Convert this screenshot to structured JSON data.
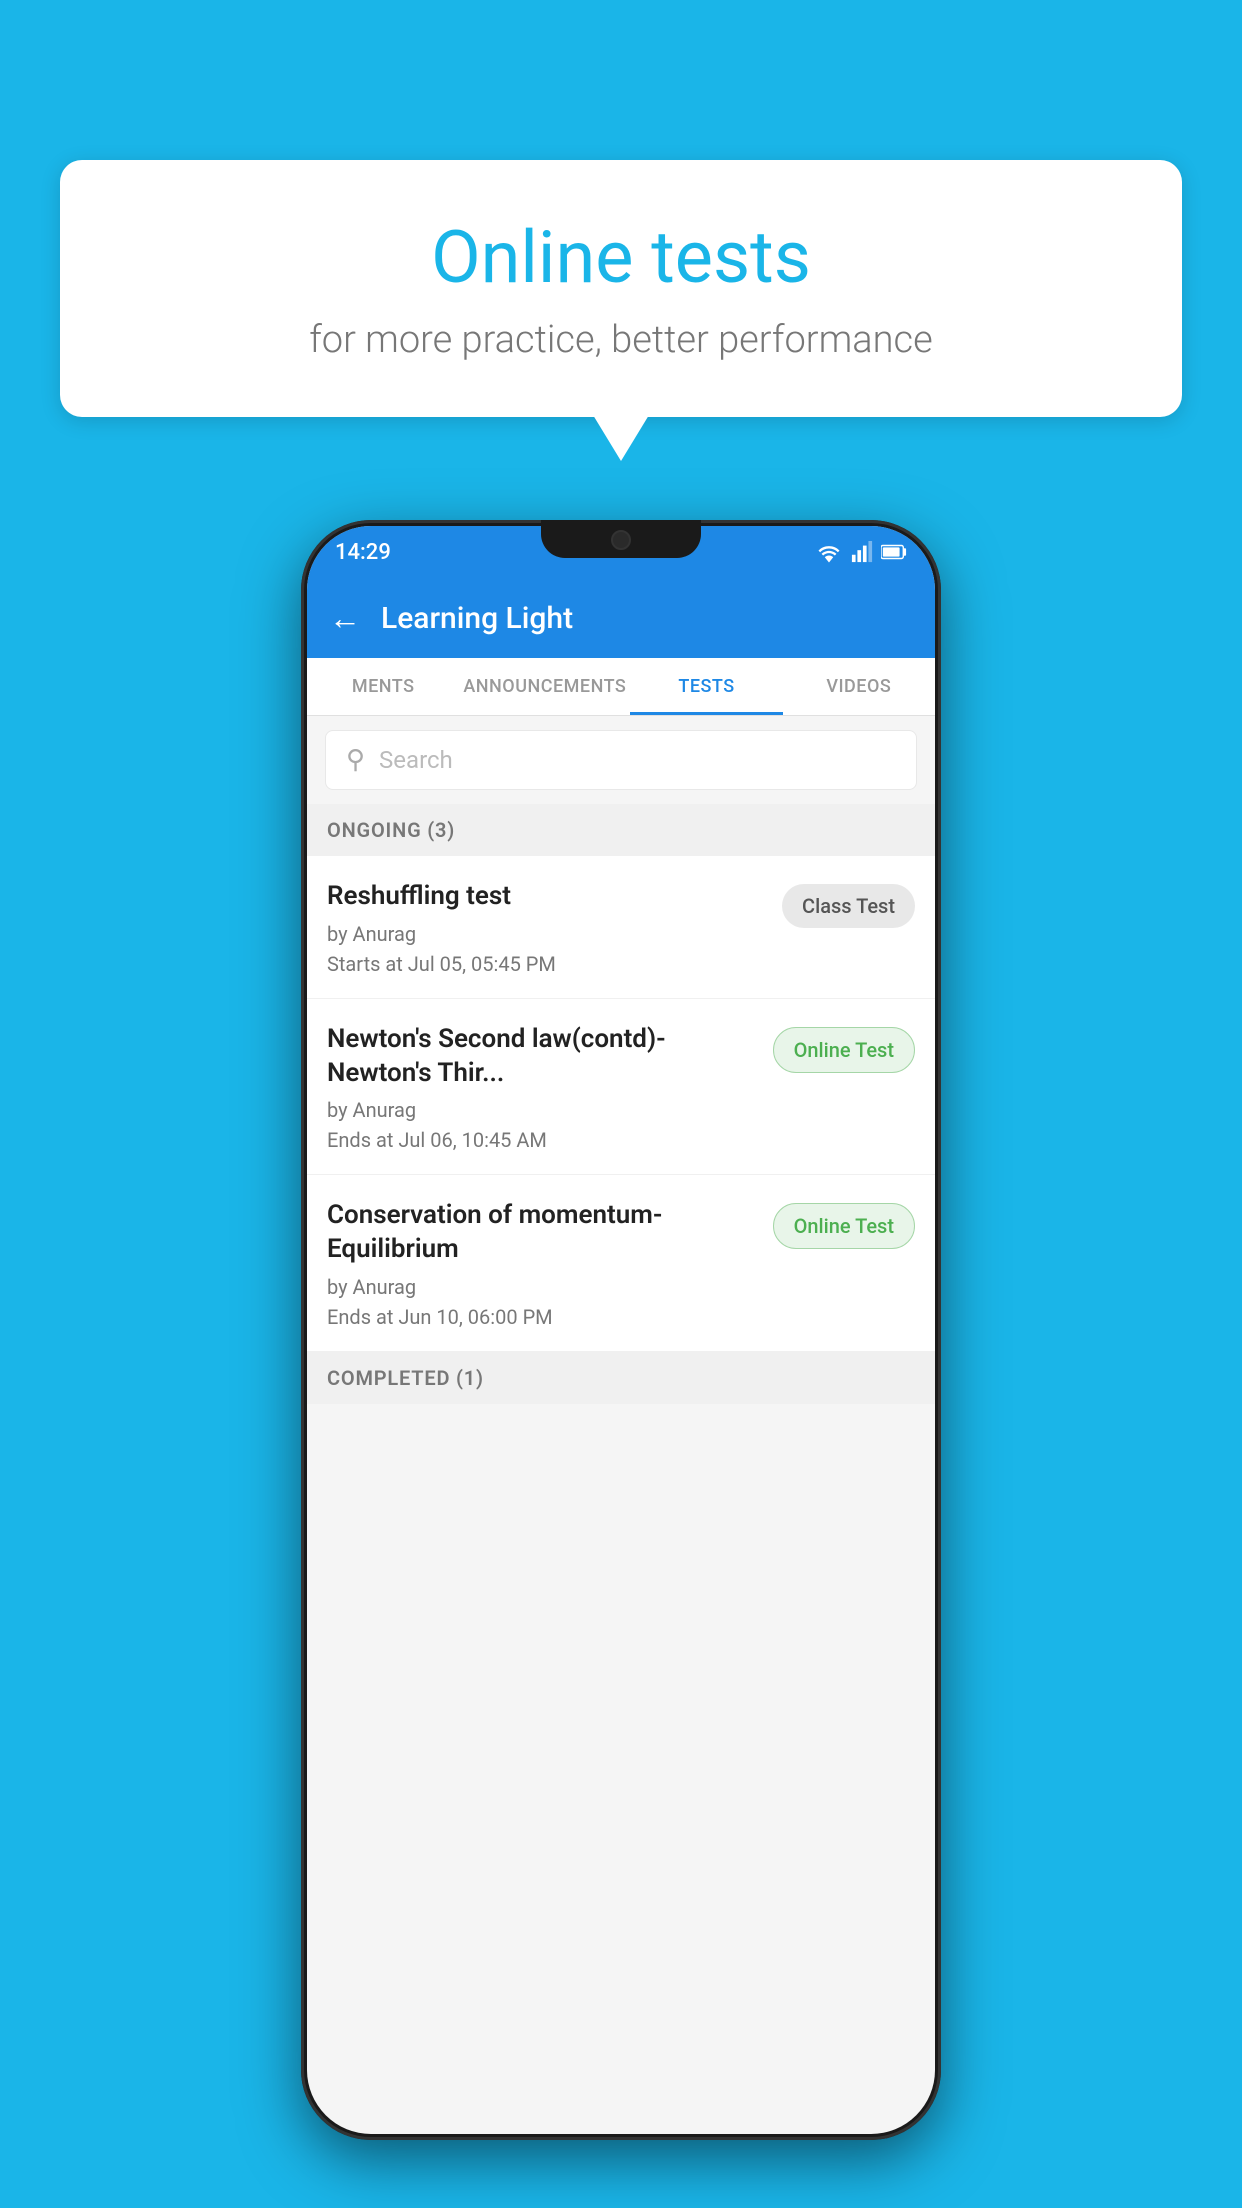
{
  "background_color": "#1ab5e8",
  "speech_bubble": {
    "title": "Online tests",
    "subtitle": "for more practice, better performance"
  },
  "phone": {
    "status_bar": {
      "time": "14:29",
      "wifi_icon": "wifi",
      "signal_icon": "signal",
      "battery_icon": "battery"
    },
    "app_header": {
      "title": "Learning Light",
      "back_label": "←"
    },
    "tabs": [
      {
        "label": "MENTS",
        "active": false
      },
      {
        "label": "ANNOUNCEMENTS",
        "active": false
      },
      {
        "label": "TESTS",
        "active": true
      },
      {
        "label": "VIDEOS",
        "active": false
      }
    ],
    "search": {
      "placeholder": "Search"
    },
    "sections": [
      {
        "title": "ONGOING (3)",
        "tests": [
          {
            "title": "Reshuffling test",
            "author": "by Anurag",
            "date": "Starts at  Jul 05, 05:45 PM",
            "badge": "Class Test",
            "badge_type": "class"
          },
          {
            "title": "Newton's Second law(contd)-Newton's Thir...",
            "author": "by Anurag",
            "date": "Ends at  Jul 06, 10:45 AM",
            "badge": "Online Test",
            "badge_type": "online"
          },
          {
            "title": "Conservation of momentum-Equilibrium",
            "author": "by Anurag",
            "date": "Ends at  Jun 10, 06:00 PM",
            "badge": "Online Test",
            "badge_type": "online"
          }
        ]
      }
    ],
    "completed_section": {
      "title": "COMPLETED (1)"
    }
  }
}
